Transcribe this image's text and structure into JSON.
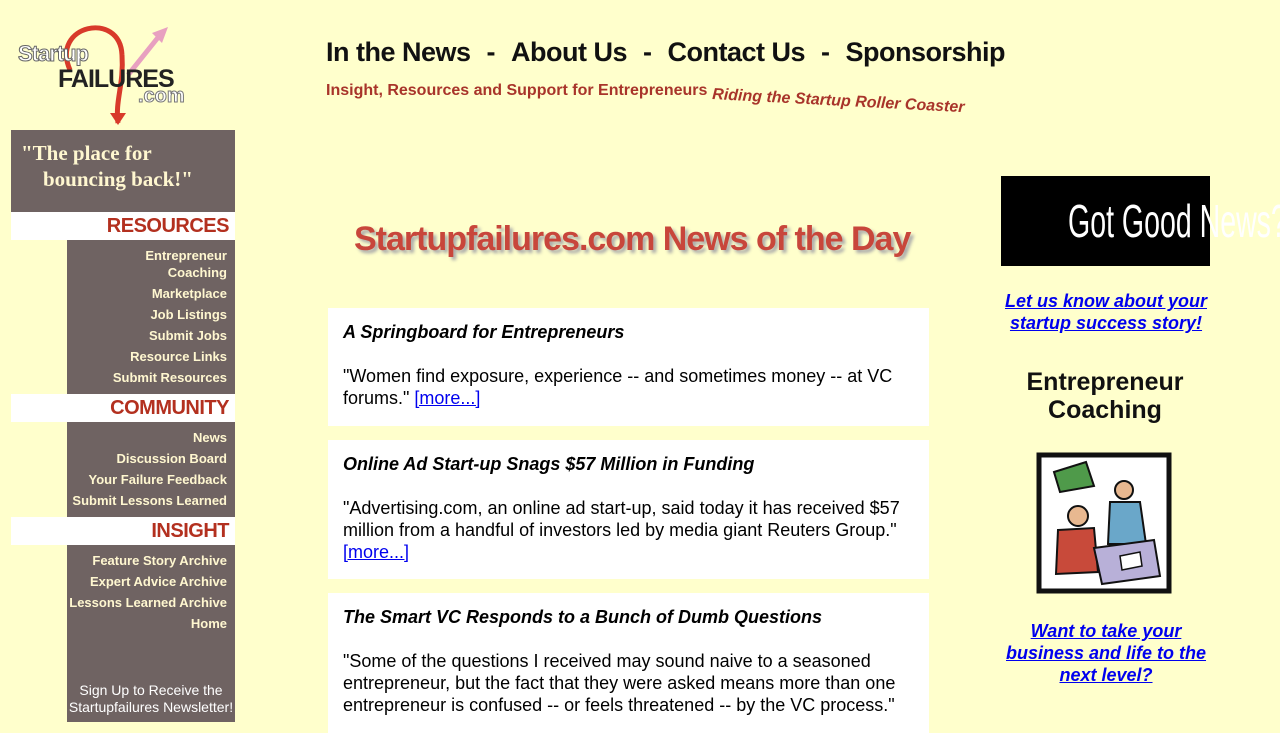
{
  "logo": {
    "word1": "Startup",
    "word2": "FAILURES",
    "word3": ".com"
  },
  "topnav": [
    "In the News",
    "About Us",
    "Contact Us",
    "Sponsorship"
  ],
  "tagline": {
    "main": "Insight, Resources and Support for Entrepreneurs",
    "arc": "Riding the Startup Roller Coaster"
  },
  "sidebar": {
    "slogan1": "\"The place for",
    "slogan2": "bouncing back!\"",
    "resources_head": "RESOURCES",
    "resources": [
      "Entrepreneur",
      "Coaching",
      "Marketplace",
      "Job Listings",
      "Submit Jobs",
      "Resource Links",
      "Submit Resources"
    ],
    "community_head": "COMMUNITY",
    "community": [
      "News",
      "Discussion Board",
      "Your Failure Feedback",
      "Submit Lessons Learned"
    ],
    "insight_head": "INSIGHT",
    "insight": [
      "Feature Story Archive",
      "Expert Advice Archive",
      "Lessons Learned Archive",
      "Home"
    ],
    "signup1": "Sign Up to Receive the",
    "signup2": "Startupfailures Newsletter!"
  },
  "main": {
    "title": "Startupfailures.com News of the Day",
    "more": "[more...]",
    "articles": [
      {
        "headline": "A Springboard for Entrepreneurs",
        "body": "\"Women find exposure, experience -- and sometimes money -- at VC forums.\""
      },
      {
        "headline": "Online Ad Start-up Snags $57 Million in Funding",
        "body": "\"Advertising.com, an online ad start-up, said today it has received $57 million from a handful of investors led by media giant Reuters Group.\""
      },
      {
        "headline": "The Smart VC Responds to a Bunch of Dumb Questions",
        "body": "\"Some of the questions I received may sound naive to a seasoned entrepreneur, but the fact that they were asked means more than one entrepreneur is confused -- or feels threatened -- by the VC process.\""
      }
    ]
  },
  "right": {
    "good_news": "Got Good News?",
    "success_link1": "Let us know about your",
    "success_link2": "startup success story!",
    "coaching_title1": "Entrepreneur",
    "coaching_title2": "Coaching",
    "next_link1": "Want to take your",
    "next_link2": "business and life to the",
    "next_link3": "next level?"
  },
  "colors": {
    "background": "#ffffcc",
    "sidebar": "#6f6362",
    "accent_red": "#c8463b",
    "link": "#0000ee"
  }
}
